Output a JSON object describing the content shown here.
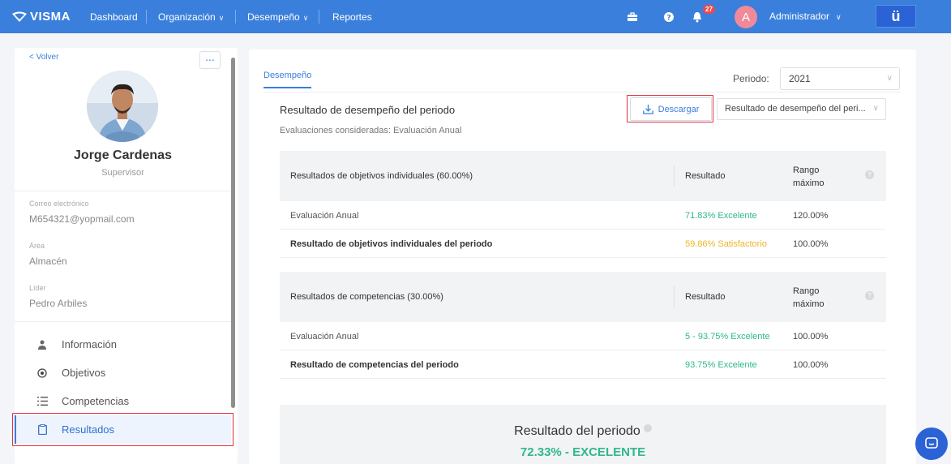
{
  "nav": {
    "logo": "VISMA",
    "items": [
      {
        "label": "Dashboard"
      },
      {
        "label": "Organización"
      },
      {
        "label": "Desempeño"
      },
      {
        "label": "Reportes"
      }
    ],
    "notification_count": "27",
    "user_initial": "A",
    "user_label": "Administrador",
    "brand_glyph": "ü",
    "accent": "#3b7fdc"
  },
  "sidebar": {
    "back_label": "< Volver",
    "more_label": "...",
    "name": "Jorge Cardenas",
    "role": "Supervisor",
    "fields": [
      {
        "label": "Correo electrónico",
        "value": "M654321@yopmail.com"
      },
      {
        "label": "Área",
        "value": "Almacén"
      },
      {
        "label": "Líder",
        "value": "Pedro Arbiles"
      }
    ],
    "menu": [
      {
        "label": "Información",
        "icon": "user-icon"
      },
      {
        "label": "Objetivos",
        "icon": "target-icon"
      },
      {
        "label": "Competencias",
        "icon": "list-icon"
      },
      {
        "label": "Resultados",
        "icon": "clipboard-icon",
        "active": true
      }
    ]
  },
  "main": {
    "tab": "Desempeño",
    "periodo_label": "Periodo:",
    "periodo_value": "2021",
    "section_title": "Resultado de desempeño del periodo",
    "section_sub": "Evaluaciones consideradas: Evaluación Anual",
    "download_label": "Descargar",
    "result_select": "Resultado de desempeño del peri...",
    "objetivos": {
      "header": "Resultados de objetivos individuales (60.00%)",
      "col_result": "Resultado",
      "col_range": "Rango máximo",
      "rows": [
        {
          "name": "Evaluación Anual",
          "result": "71.83% Excelente",
          "range": "120.00%",
          "color": "#2fb88a"
        },
        {
          "name": "Resultado de objetivos individuales del periodo",
          "result": "59.86% Satisfactorio",
          "range": "100.00%",
          "color": "#f0b429"
        }
      ]
    },
    "competencias": {
      "header": "Resultados de competencias (30.00%)",
      "col_result": "Resultado",
      "col_range": "Rango máximo",
      "rows": [
        {
          "name": "Evaluación Anual",
          "result": "5 - 93.75% Excelente",
          "range": "100.00%",
          "color": "#2fb88a"
        },
        {
          "name": "Resultado de competencias del periodo",
          "result": "93.75% Excelente",
          "range": "100.00%",
          "color": "#2fb88a"
        }
      ]
    },
    "summary_title": "Resultado del periodo",
    "summary_value": "72.33% - EXCELENTE"
  }
}
